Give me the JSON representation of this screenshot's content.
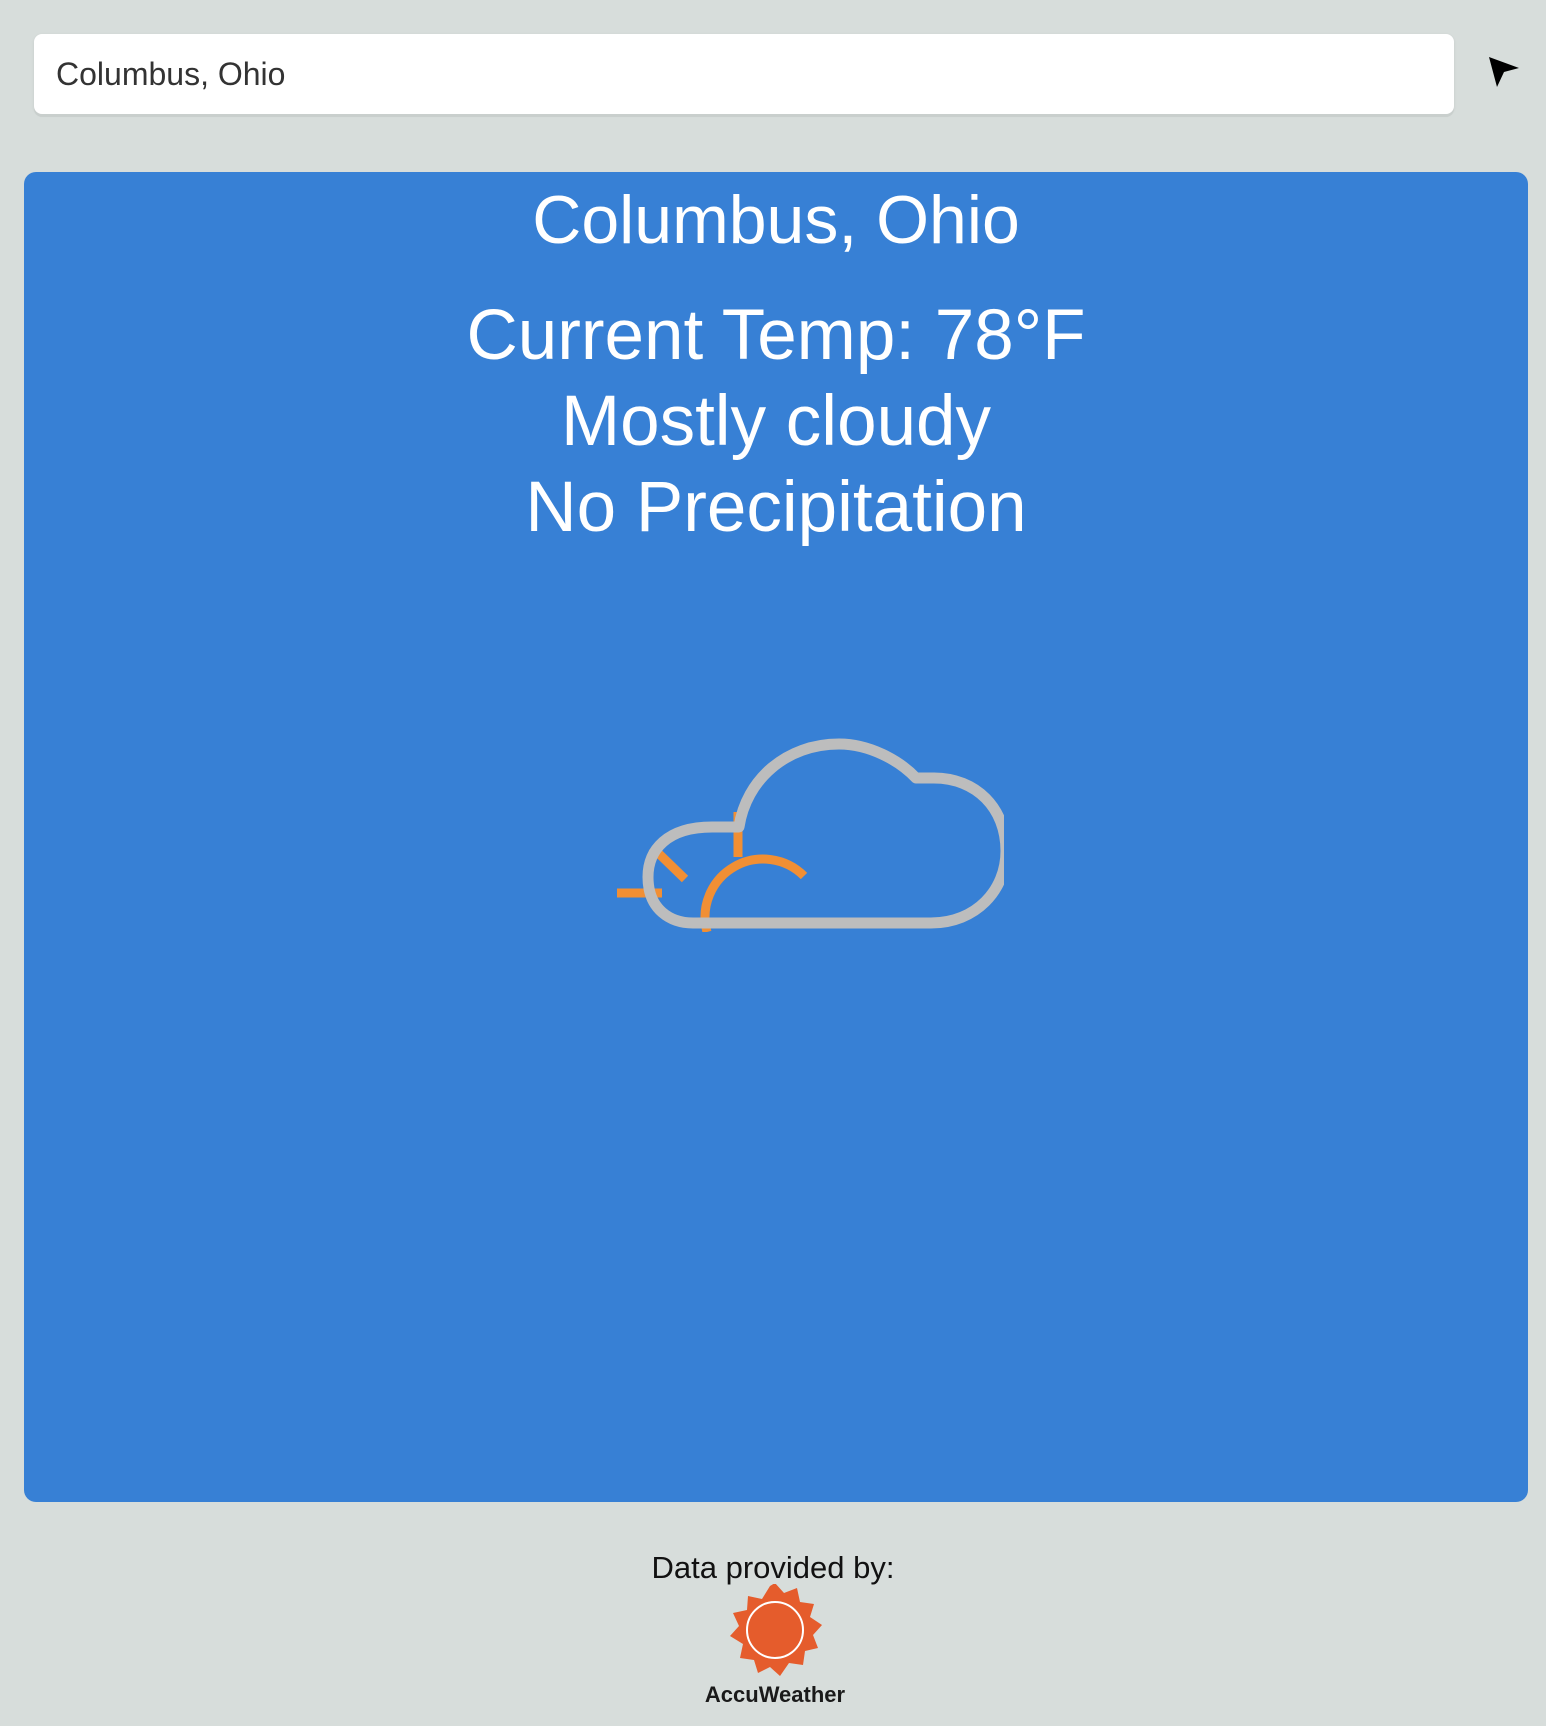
{
  "search": {
    "value": "Columbus, Ohio"
  },
  "location_button": {
    "icon": "location-arrow-icon"
  },
  "weather": {
    "city": "Columbus, Ohio",
    "current_temp": "Current Temp: 78°F",
    "condition": "Mostly cloudy",
    "precipitation": "No Precipitation",
    "icon": "partly-cloudy-icon"
  },
  "footer": {
    "credit_label": "Data provided by:",
    "provider_name": "AccuWeather",
    "provider_logo_icon": "accuweather-sun-logo-icon"
  },
  "colors": {
    "page_background": "#d7dddb",
    "card_background": "#3780d5",
    "sun_orange": "#f18f34",
    "cloud_gray": "#bdbdbd",
    "logo_orange": "#e55c2c"
  }
}
